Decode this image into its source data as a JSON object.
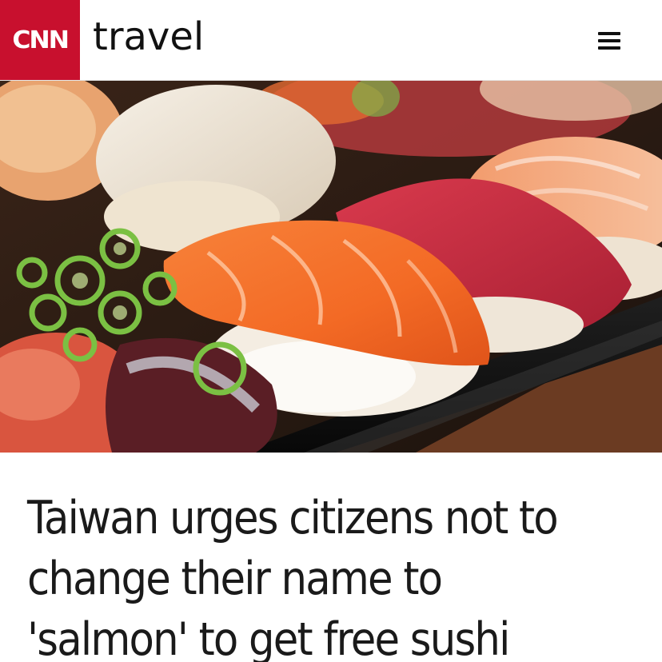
{
  "header": {
    "logo_text": "CNN",
    "section": "travel",
    "menu_icon": "hamburger-menu-icon"
  },
  "hero": {
    "alt_semantic": "sushi-photo"
  },
  "article": {
    "headline": "Taiwan urges citizens not to change their name to 'salmon' to get free sushi"
  },
  "colors": {
    "brand_red": "#c8102e",
    "text": "#1a1a1a",
    "background": "#ffffff"
  }
}
